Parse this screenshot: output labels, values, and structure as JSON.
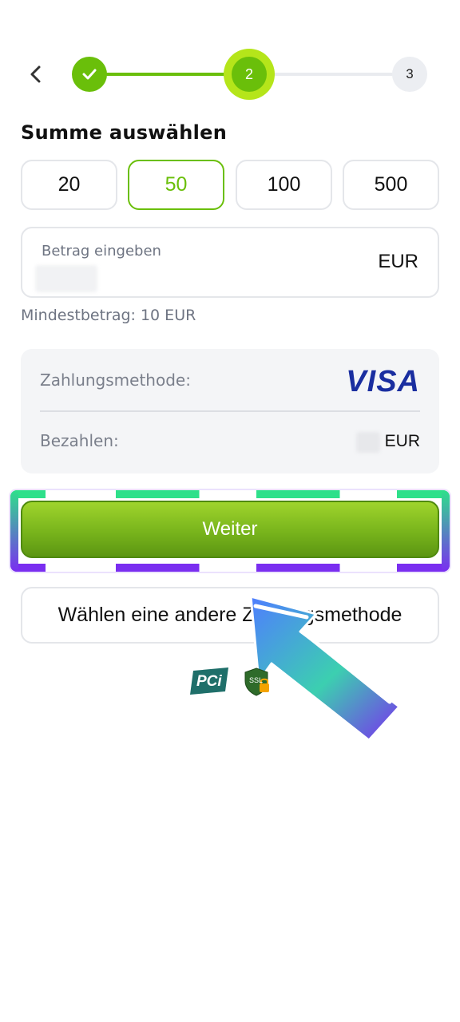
{
  "stepper": {
    "back_icon": "chevron-left-icon",
    "step1_icon": "check-icon",
    "step2_label": "2",
    "step3_label": "3",
    "active_color": "#6abf0a",
    "active_ring_color": "#b5e51a"
  },
  "section_title": "Summe auswählen",
  "amounts": [
    {
      "label": "20",
      "selected": false
    },
    {
      "label": "50",
      "selected": true
    },
    {
      "label": "100",
      "selected": false
    },
    {
      "label": "500",
      "selected": false
    }
  ],
  "amount_input": {
    "label": "Betrag eingeben",
    "currency": "EUR"
  },
  "minimum_text": "Mindestbetrag: 10 EUR",
  "summary": {
    "method_label": "Zahlungsmethode:",
    "method_logo_text": "VISA",
    "pay_label": "Bezahlen:",
    "pay_currency": "EUR"
  },
  "continue_button": "Weiter",
  "other_method_button": "Wählen eine andere Zahlungsmethode",
  "badges": {
    "pci_text": "PCi",
    "ssl_text": "SSL"
  },
  "colors": {
    "brand_green": "#6abf0a",
    "visa_blue": "#1a2ea0",
    "highlight_green": "#2ee08a",
    "highlight_purple": "#7a2ef0"
  }
}
